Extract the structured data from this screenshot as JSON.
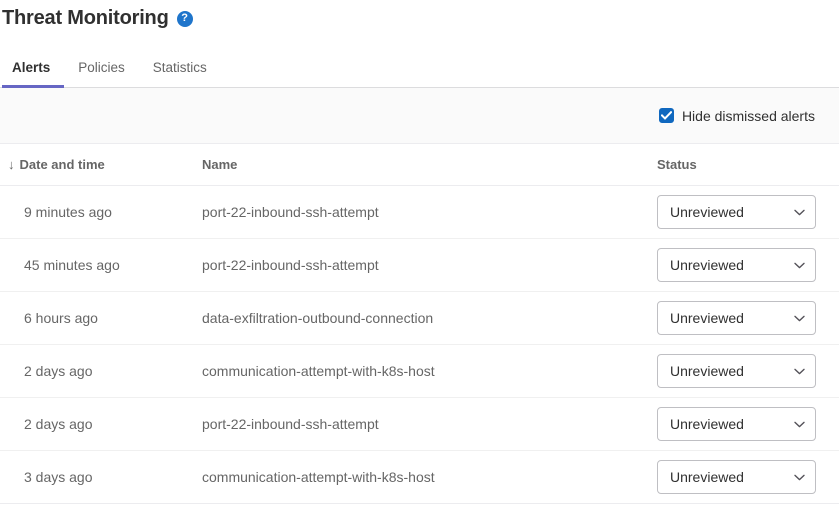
{
  "header": {
    "title": "Threat Monitoring",
    "help_icon": "help-circle-icon",
    "help_glyph": "?"
  },
  "tabs": [
    {
      "label": "Alerts",
      "active": true
    },
    {
      "label": "Policies",
      "active": false
    },
    {
      "label": "Statistics",
      "active": false
    }
  ],
  "toolbar": {
    "hide_dismissed": {
      "label": "Hide dismissed alerts",
      "checked": true
    }
  },
  "table": {
    "columns": [
      {
        "label": "Date and time",
        "sort": "descending",
        "sort_glyph": "↓"
      },
      {
        "label": "Name"
      },
      {
        "label": "Status"
      }
    ],
    "rows": [
      {
        "date": "9 minutes ago",
        "name": "port-22-inbound-ssh-attempt",
        "status": "Unreviewed"
      },
      {
        "date": "45 minutes ago",
        "name": "port-22-inbound-ssh-attempt",
        "status": "Unreviewed"
      },
      {
        "date": "6 hours ago",
        "name": "data-exfiltration-outbound-connection",
        "status": "Unreviewed"
      },
      {
        "date": "2 days ago",
        "name": "communication-attempt-with-k8s-host",
        "status": "Unreviewed"
      },
      {
        "date": "2 days ago",
        "name": "port-22-inbound-ssh-attempt",
        "status": "Unreviewed"
      },
      {
        "date": "3 days ago",
        "name": "communication-attempt-with-k8s-host",
        "status": "Unreviewed"
      }
    ]
  },
  "colors": {
    "accent_tab": "#6666c4",
    "checkbox_blue": "#1068bf",
    "help_blue": "#1f75cb",
    "text_primary": "#303030",
    "text_secondary": "#666666",
    "toolbar_bg": "#fafafa"
  }
}
